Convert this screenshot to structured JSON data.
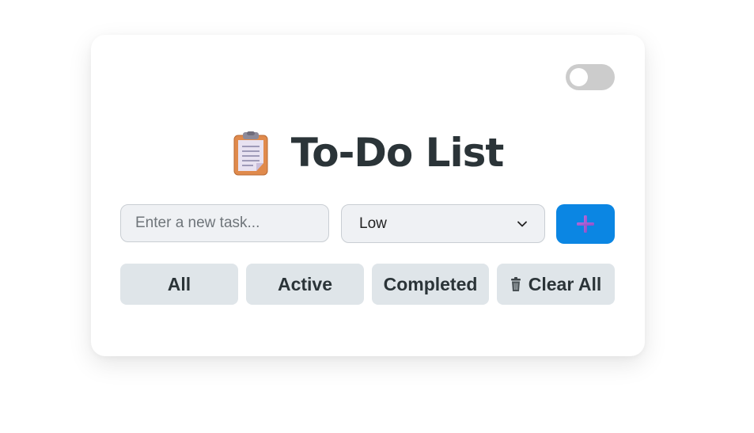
{
  "app": {
    "title": "To-Do List",
    "title_icon": "clipboard-icon",
    "theme_toggle": {
      "state": "off",
      "icon": "toggle-switch"
    }
  },
  "form": {
    "task_input": {
      "placeholder": "Enter a new task...",
      "value": ""
    },
    "priority_select": {
      "selected": "Low",
      "icon": "chevron-down-icon"
    },
    "add_button": {
      "icon": "plus-icon",
      "color": "#0b86e3"
    }
  },
  "filters": [
    {
      "label": "All"
    },
    {
      "label": "Active"
    },
    {
      "label": "Completed"
    }
  ],
  "clear_all": {
    "label": "Clear All",
    "icon": "trash-icon"
  },
  "colors": {
    "accent": "#0b86e3",
    "filter_bg": "#dfe5e9",
    "text": "#2b3438"
  }
}
